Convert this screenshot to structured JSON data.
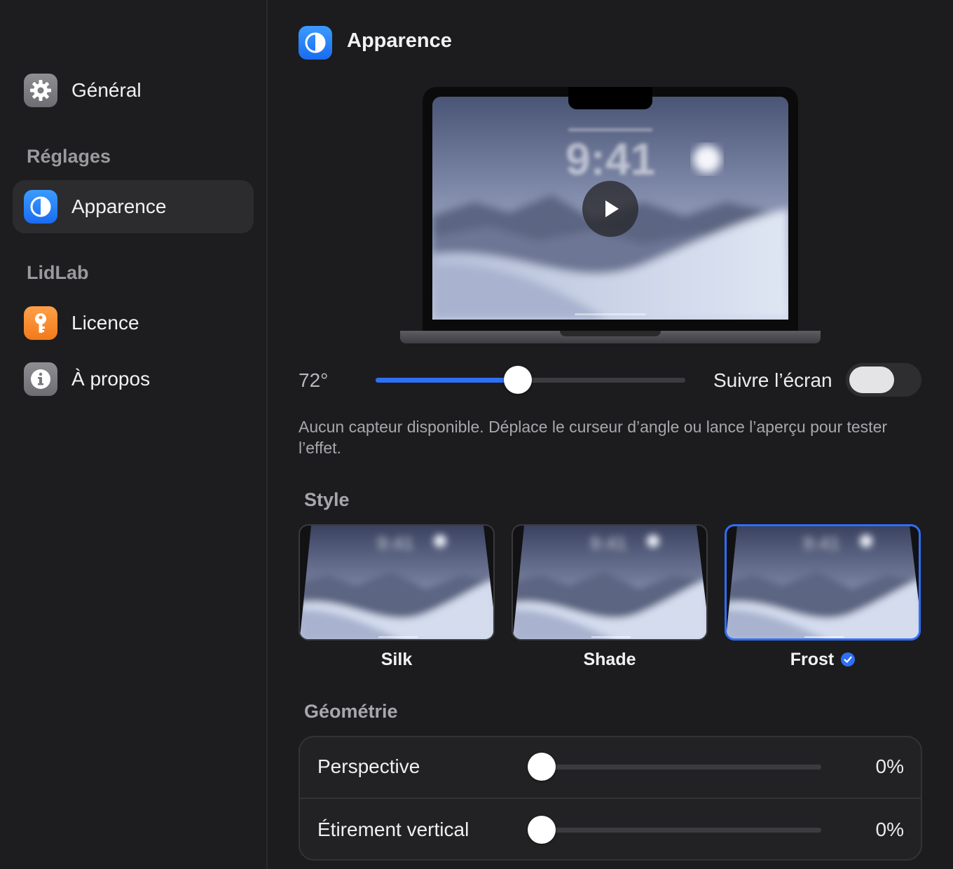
{
  "sidebar": {
    "general": {
      "label": "Général",
      "icon": "gear-icon"
    },
    "sections": [
      {
        "title": "Réglages"
      },
      {
        "title": "LidLab"
      }
    ],
    "items": [
      {
        "label": "Apparence",
        "icon": "contrast-icon",
        "active": true
      },
      {
        "label": "Licence",
        "icon": "key-icon"
      },
      {
        "label": "À propos",
        "icon": "info-icon"
      }
    ]
  },
  "header": {
    "title": "Apparence",
    "icon": "contrast-icon"
  },
  "preview": {
    "time": "9:41",
    "play_icon": "play-icon"
  },
  "angle": {
    "value_label": "72°",
    "slider_fraction": 0.46,
    "follow_label": "Suivre l’écran",
    "follow_enabled": false
  },
  "hint": "Aucun capteur disponible. Déplace le curseur d’angle ou lance l’aperçu pour tester l’effet.",
  "style": {
    "title": "Style",
    "options": [
      {
        "label": "Silk",
        "selected": false
      },
      {
        "label": "Shade",
        "selected": false
      },
      {
        "label": "Frost",
        "selected": true
      }
    ]
  },
  "geometry": {
    "title": "Géométrie",
    "rows": [
      {
        "label": "Perspective",
        "value": "0%",
        "fraction": 0
      },
      {
        "label": "Étirement vertical",
        "value": "0%",
        "fraction": 0
      }
    ]
  },
  "colors": {
    "accent": "#2f6ff5",
    "background": "#1c1c1e",
    "sidebar_active": "#2c2c2e"
  }
}
